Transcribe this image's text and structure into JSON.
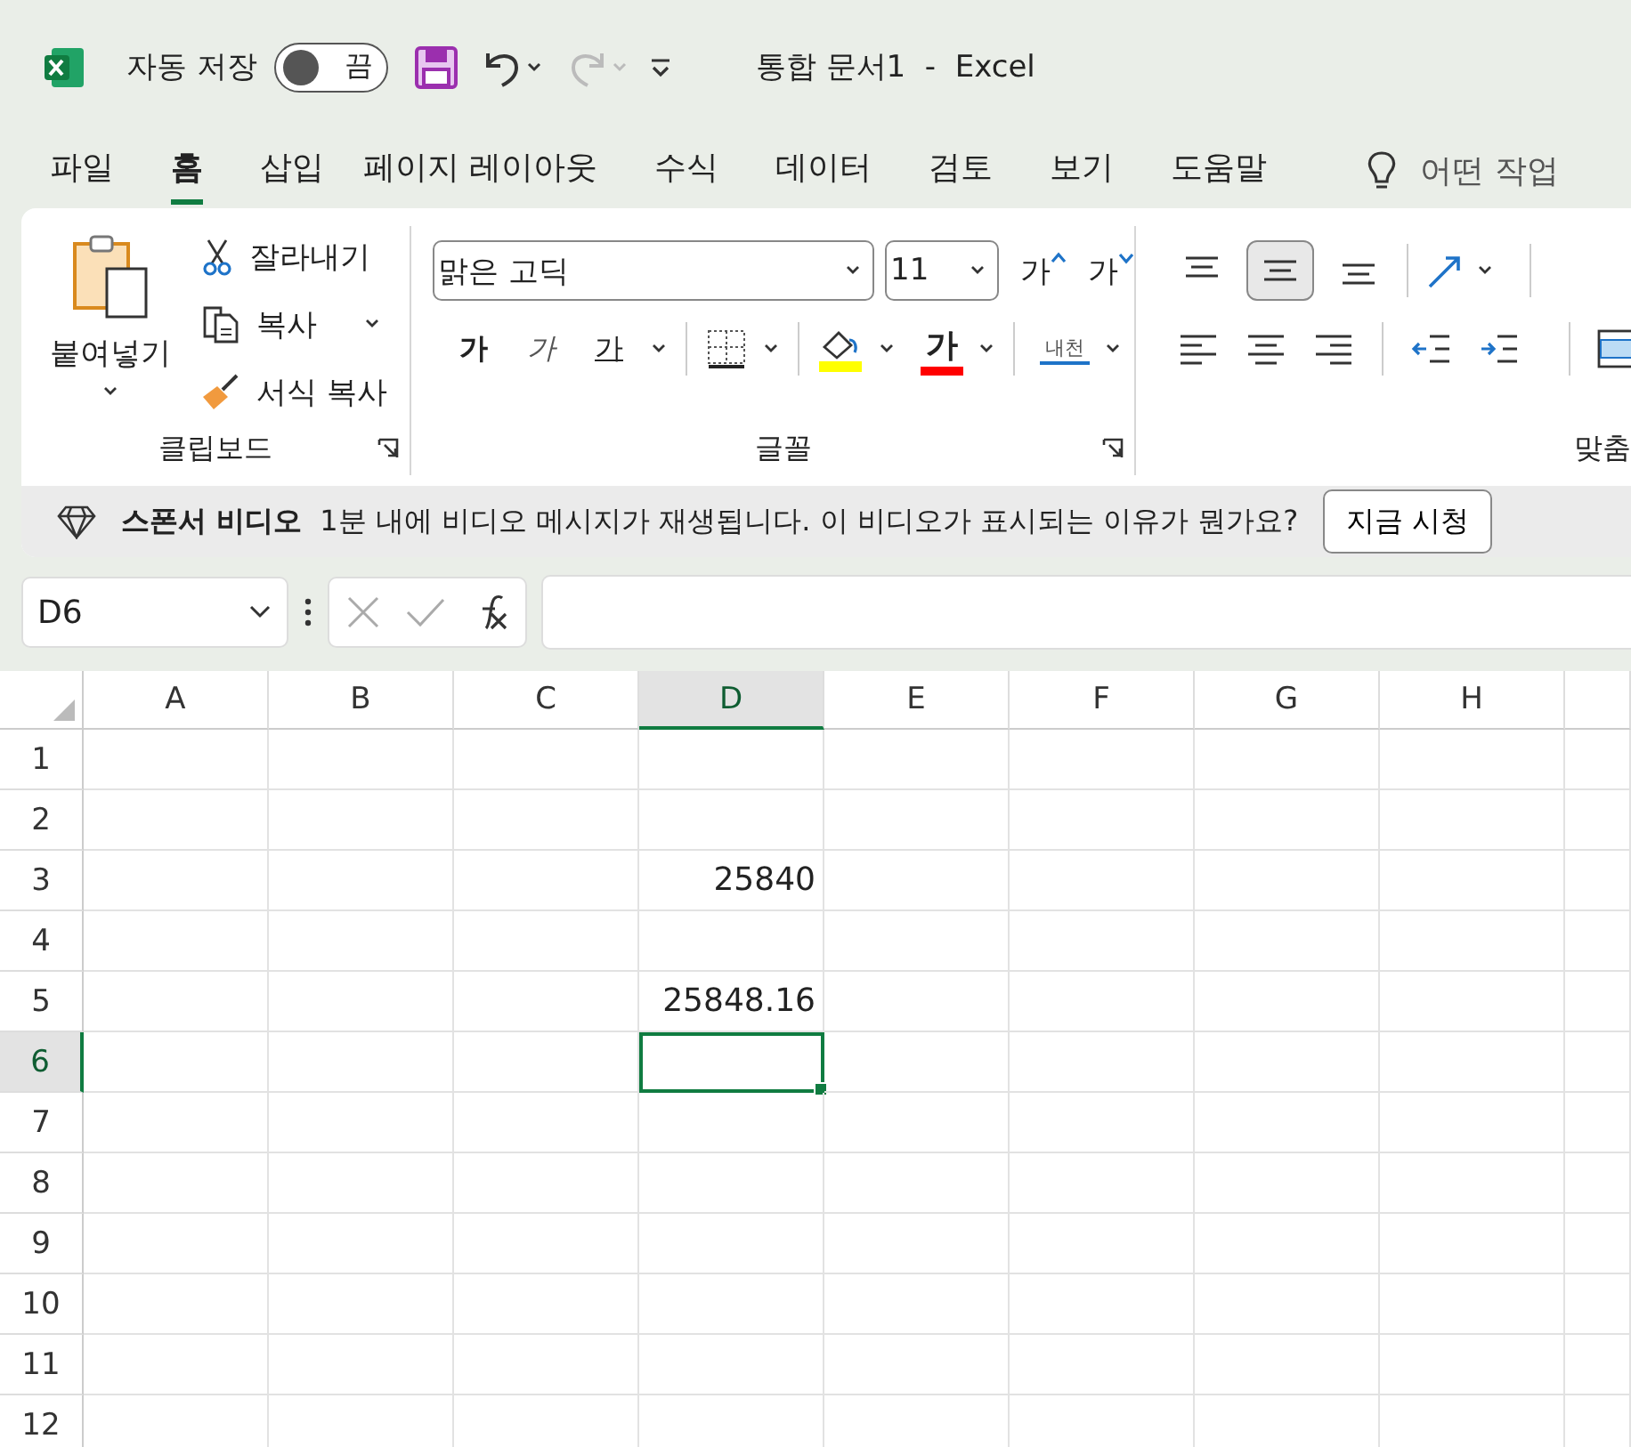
{
  "title_bar": {
    "autosave_label": "자동 저장",
    "autosave": {
      "on": false,
      "label": "끔"
    },
    "redo_disabled": true,
    "document_title": "통합 문서1  -  Excel"
  },
  "tabs": [
    {
      "label": "파일",
      "selected": false
    },
    {
      "label": "홈",
      "selected": true
    },
    {
      "label": "삽입",
      "selected": false
    },
    {
      "label": "페이지 레이아웃",
      "selected": false
    },
    {
      "label": "수식",
      "selected": false
    },
    {
      "label": "데이터",
      "selected": false
    },
    {
      "label": "검토",
      "selected": false
    },
    {
      "label": "보기",
      "selected": false
    },
    {
      "label": "도움말",
      "selected": false
    }
  ],
  "tell_me": {
    "placeholder": "어떤 작업"
  },
  "ribbon": {
    "clipboard": {
      "label": "클립보드",
      "paste": "붙여넣기",
      "cut": "잘라내기",
      "copy": "복사",
      "format_painter": "서식 복사"
    },
    "font": {
      "label": "글꼴",
      "font_name": "맑은 고딕",
      "font_size": "11",
      "grow": "가",
      "shrink": "가",
      "bold": "가",
      "italic": "가",
      "underline": "가",
      "font_color": "가",
      "phonetic": "내천"
    },
    "alignment": {
      "label": "맞춤",
      "vertical": [
        {
          "selected": false
        },
        {
          "selected": true
        },
        {
          "selected": false
        }
      ]
    }
  },
  "message_bar": {
    "title": "스폰서 비디오",
    "text": "1분 내에 비디오 메시지가 재생됩니다. 이 비디오가 표시되는 이유가 뭔가요?",
    "button": "지금 시청"
  },
  "formula_bar": {
    "name_box": "D6"
  },
  "sheet": {
    "columns": [
      {
        "label": "A",
        "selected": false
      },
      {
        "label": "B",
        "selected": false
      },
      {
        "label": "C",
        "selected": false
      },
      {
        "label": "D",
        "selected": true
      },
      {
        "label": "E",
        "selected": false
      },
      {
        "label": "F",
        "selected": false
      },
      {
        "label": "G",
        "selected": false
      },
      {
        "label": "H",
        "selected": false
      }
    ],
    "rows": [
      {
        "label": "1",
        "selected": false,
        "cells": [
          null,
          null,
          null,
          null,
          null,
          null,
          null,
          null
        ]
      },
      {
        "label": "2",
        "selected": false,
        "cells": [
          null,
          null,
          null,
          null,
          null,
          null,
          null,
          null
        ]
      },
      {
        "label": "3",
        "selected": false,
        "cells": [
          null,
          null,
          null,
          "25840",
          null,
          null,
          null,
          null
        ]
      },
      {
        "label": "4",
        "selected": false,
        "cells": [
          null,
          null,
          null,
          null,
          null,
          null,
          null,
          null
        ]
      },
      {
        "label": "5",
        "selected": false,
        "cells": [
          null,
          null,
          null,
          "25848.16",
          null,
          null,
          null,
          null
        ]
      },
      {
        "label": "6",
        "selected": true,
        "cells": [
          null,
          null,
          null,
          null,
          null,
          null,
          null,
          null
        ]
      },
      {
        "label": "7",
        "selected": false,
        "cells": [
          null,
          null,
          null,
          null,
          null,
          null,
          null,
          null
        ]
      },
      {
        "label": "8",
        "selected": false,
        "cells": [
          null,
          null,
          null,
          null,
          null,
          null,
          null,
          null
        ]
      },
      {
        "label": "9",
        "selected": false,
        "cells": [
          null,
          null,
          null,
          null,
          null,
          null,
          null,
          null
        ]
      },
      {
        "label": "10",
        "selected": false,
        "cells": [
          null,
          null,
          null,
          null,
          null,
          null,
          null,
          null
        ]
      },
      {
        "label": "11",
        "selected": false,
        "cells": [
          null,
          null,
          null,
          null,
          null,
          null,
          null,
          null
        ]
      },
      {
        "label": "12",
        "selected": false,
        "cells": [
          null,
          null,
          null,
          null,
          null,
          null,
          null,
          null
        ]
      }
    ]
  }
}
